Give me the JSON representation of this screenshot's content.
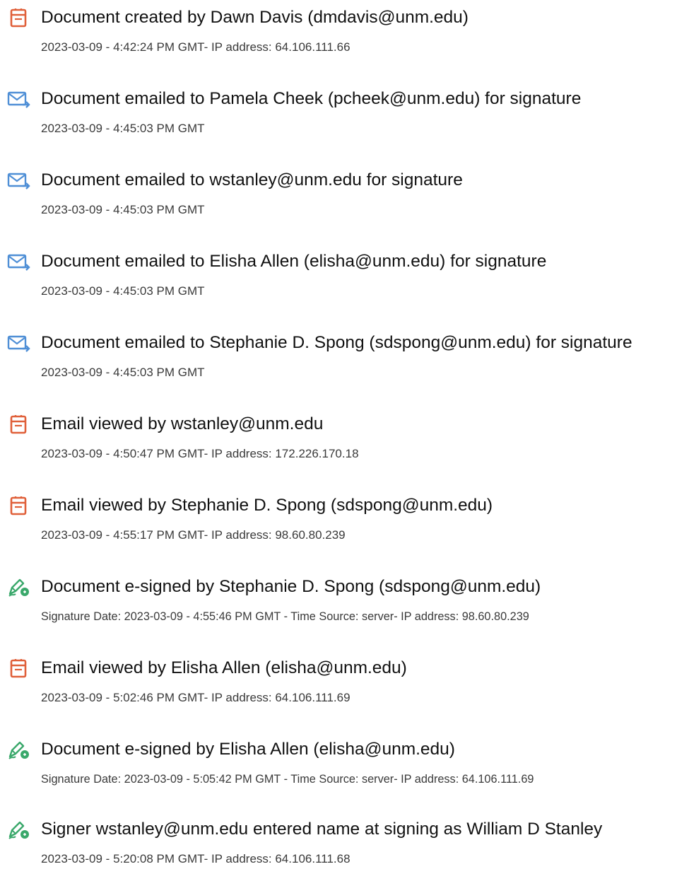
{
  "events": [
    {
      "icon": "document-icon",
      "title": "Document created by Dawn Davis (dmdavis@unm.edu)",
      "detail": "2023-03-09 - 4:42:24 PM GMT- IP address: 64.106.111.66"
    },
    {
      "icon": "email-sent-icon",
      "title": "Document emailed to Pamela Cheek (pcheek@unm.edu) for signature",
      "detail": "2023-03-09 - 4:45:03 PM GMT"
    },
    {
      "icon": "email-sent-icon",
      "title": "Document emailed to wstanley@unm.edu for signature",
      "detail": "2023-03-09 - 4:45:03 PM GMT"
    },
    {
      "icon": "email-sent-icon",
      "title": "Document emailed to Elisha Allen (elisha@unm.edu) for signature",
      "detail": "2023-03-09 - 4:45:03 PM GMT"
    },
    {
      "icon": "email-sent-icon",
      "title": "Document emailed to Stephanie D. Spong (sdspong@unm.edu) for signature",
      "detail": "2023-03-09 - 4:45:03 PM GMT"
    },
    {
      "icon": "document-icon",
      "title": "Email viewed by wstanley@unm.edu",
      "detail": "2023-03-09 - 4:50:47 PM GMT- IP address: 172.226.170.18"
    },
    {
      "icon": "document-icon",
      "title": "Email viewed by Stephanie D. Spong (sdspong@unm.edu)",
      "detail": "2023-03-09 - 4:55:17 PM GMT- IP address: 98.60.80.239"
    },
    {
      "icon": "signature-pen-icon",
      "title": "Document e-signed by Stephanie D. Spong (sdspong@unm.edu)",
      "detail": "Signature Date: 2023-03-09 - 4:55:46 PM GMT - Time Source: server- IP address: 98.60.80.239"
    },
    {
      "icon": "document-icon",
      "title": "Email viewed by Elisha Allen (elisha@unm.edu)",
      "detail": "2023-03-09 - 5:02:46 PM GMT- IP address: 64.106.111.69"
    },
    {
      "icon": "signature-pen-icon",
      "title": "Document e-signed by Elisha Allen (elisha@unm.edu)",
      "detail": "Signature Date: 2023-03-09 - 5:05:42 PM GMT - Time Source: server- IP address: 64.106.111.69"
    },
    {
      "icon": "signature-pen-icon",
      "title": "Signer wstanley@unm.edu entered name at signing as William D Stanley",
      "detail": "2023-03-09 - 5:20:08 PM GMT- IP address: 64.106.111.68"
    }
  ],
  "colors": {
    "document_icon": "#e0603a",
    "email_icon": "#4f8fd6",
    "signature_icon": "#3aa86b"
  }
}
